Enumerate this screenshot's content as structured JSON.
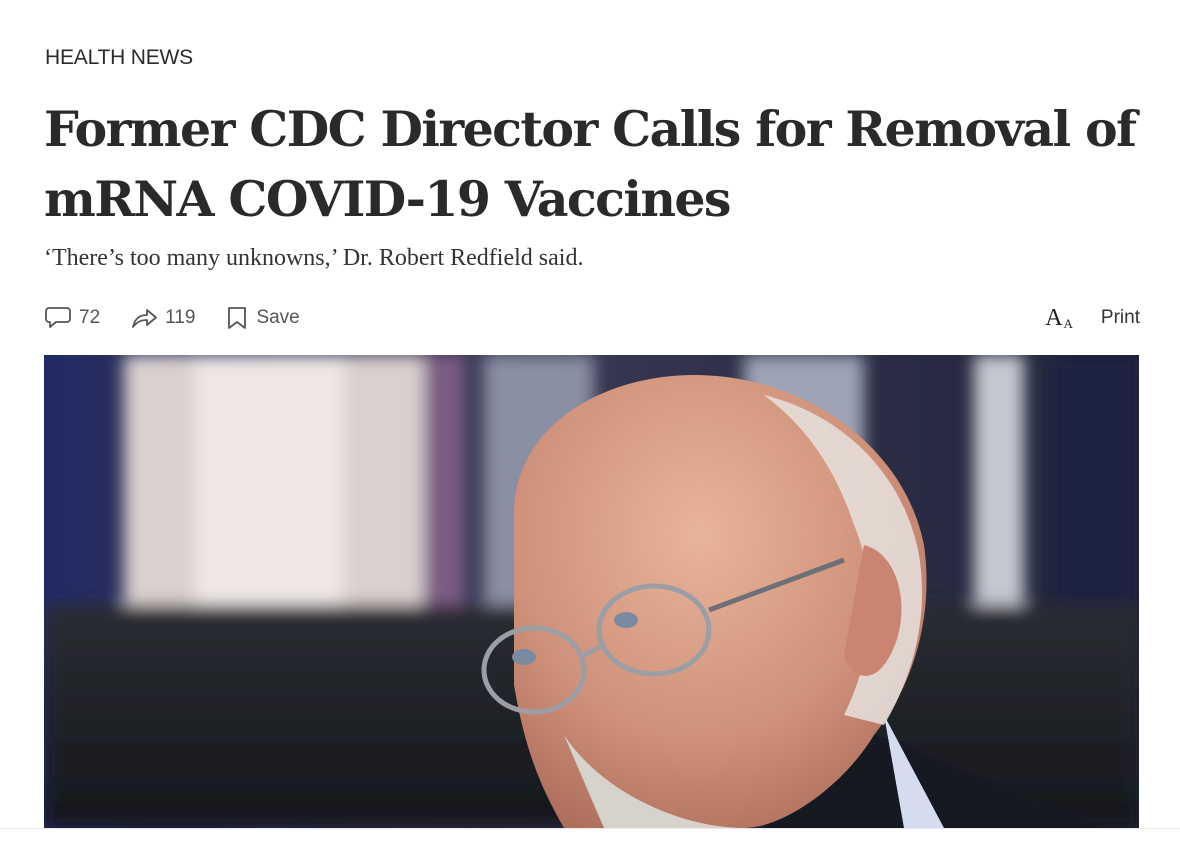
{
  "article": {
    "section": "HEALTH NEWS",
    "headline": "Former CDC Director Calls for Removal of mRNA COVID-19 Vaccines",
    "dek": "‘There’s too many unknowns,’ Dr. Robert Redfield said."
  },
  "toolbar": {
    "comments": {
      "icon": "comment-icon",
      "count": "72"
    },
    "shares": {
      "icon": "share-icon",
      "count": "119"
    },
    "save": {
      "icon": "bookmark-icon",
      "label": "Save"
    },
    "font_size": {
      "icon": "font-size-icon"
    },
    "print": {
      "label": "Print"
    }
  },
  "colors": {
    "headline": "#2a2a2a",
    "toolbar_text": "#555555",
    "hero_background": "#2c3142"
  }
}
